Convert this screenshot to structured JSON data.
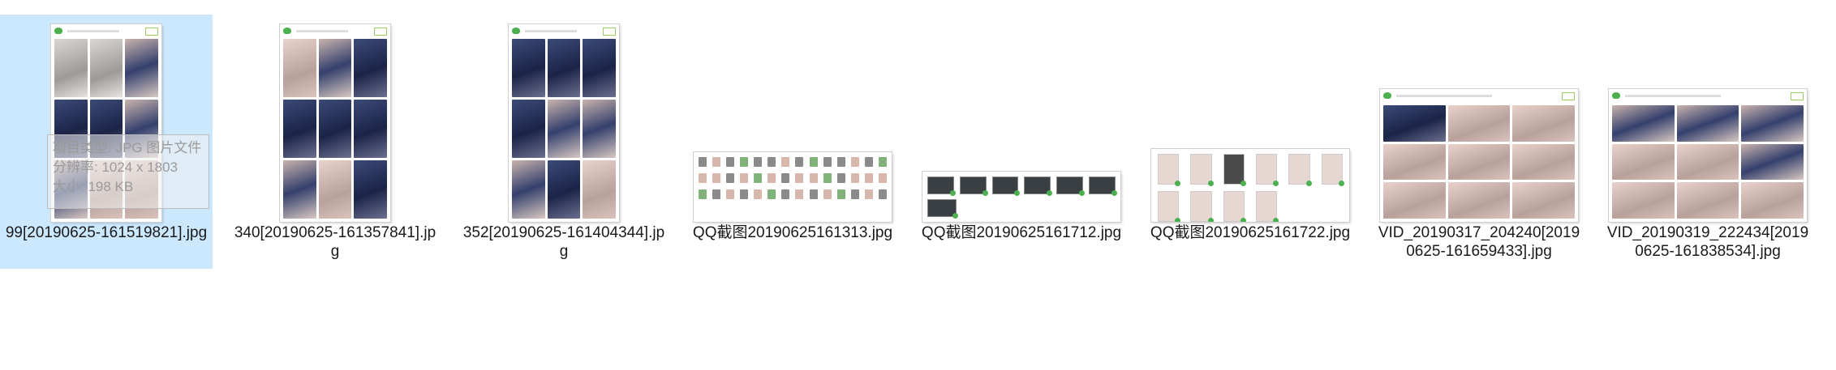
{
  "files": [
    {
      "name": "99[20190625-161519821].jpg",
      "selected": true
    },
    {
      "name": "340[20190625-161357841].jpg",
      "selected": false
    },
    {
      "name": "352[20190625-161404344].jpg",
      "selected": false
    },
    {
      "name": "QQ截图20190625161313.jpg",
      "selected": false
    },
    {
      "name": "QQ截图20190625161712.jpg",
      "selected": false
    },
    {
      "name": "QQ截图20190625161722.jpg",
      "selected": false
    },
    {
      "name": "VID_20190317_204240[20190625-161659433].jpg",
      "selected": false
    },
    {
      "name": "VID_20190319_222434[20190625-161838534].jpg",
      "selected": false
    }
  ],
  "tooltip": {
    "line1": "项目类型: JPG 图片文件",
    "line2": "分辨率: 1024 x 1803",
    "line3": "大小: 198 KB"
  },
  "colors": {
    "selection": "#cce8ff",
    "accent": "#4caf50"
  }
}
